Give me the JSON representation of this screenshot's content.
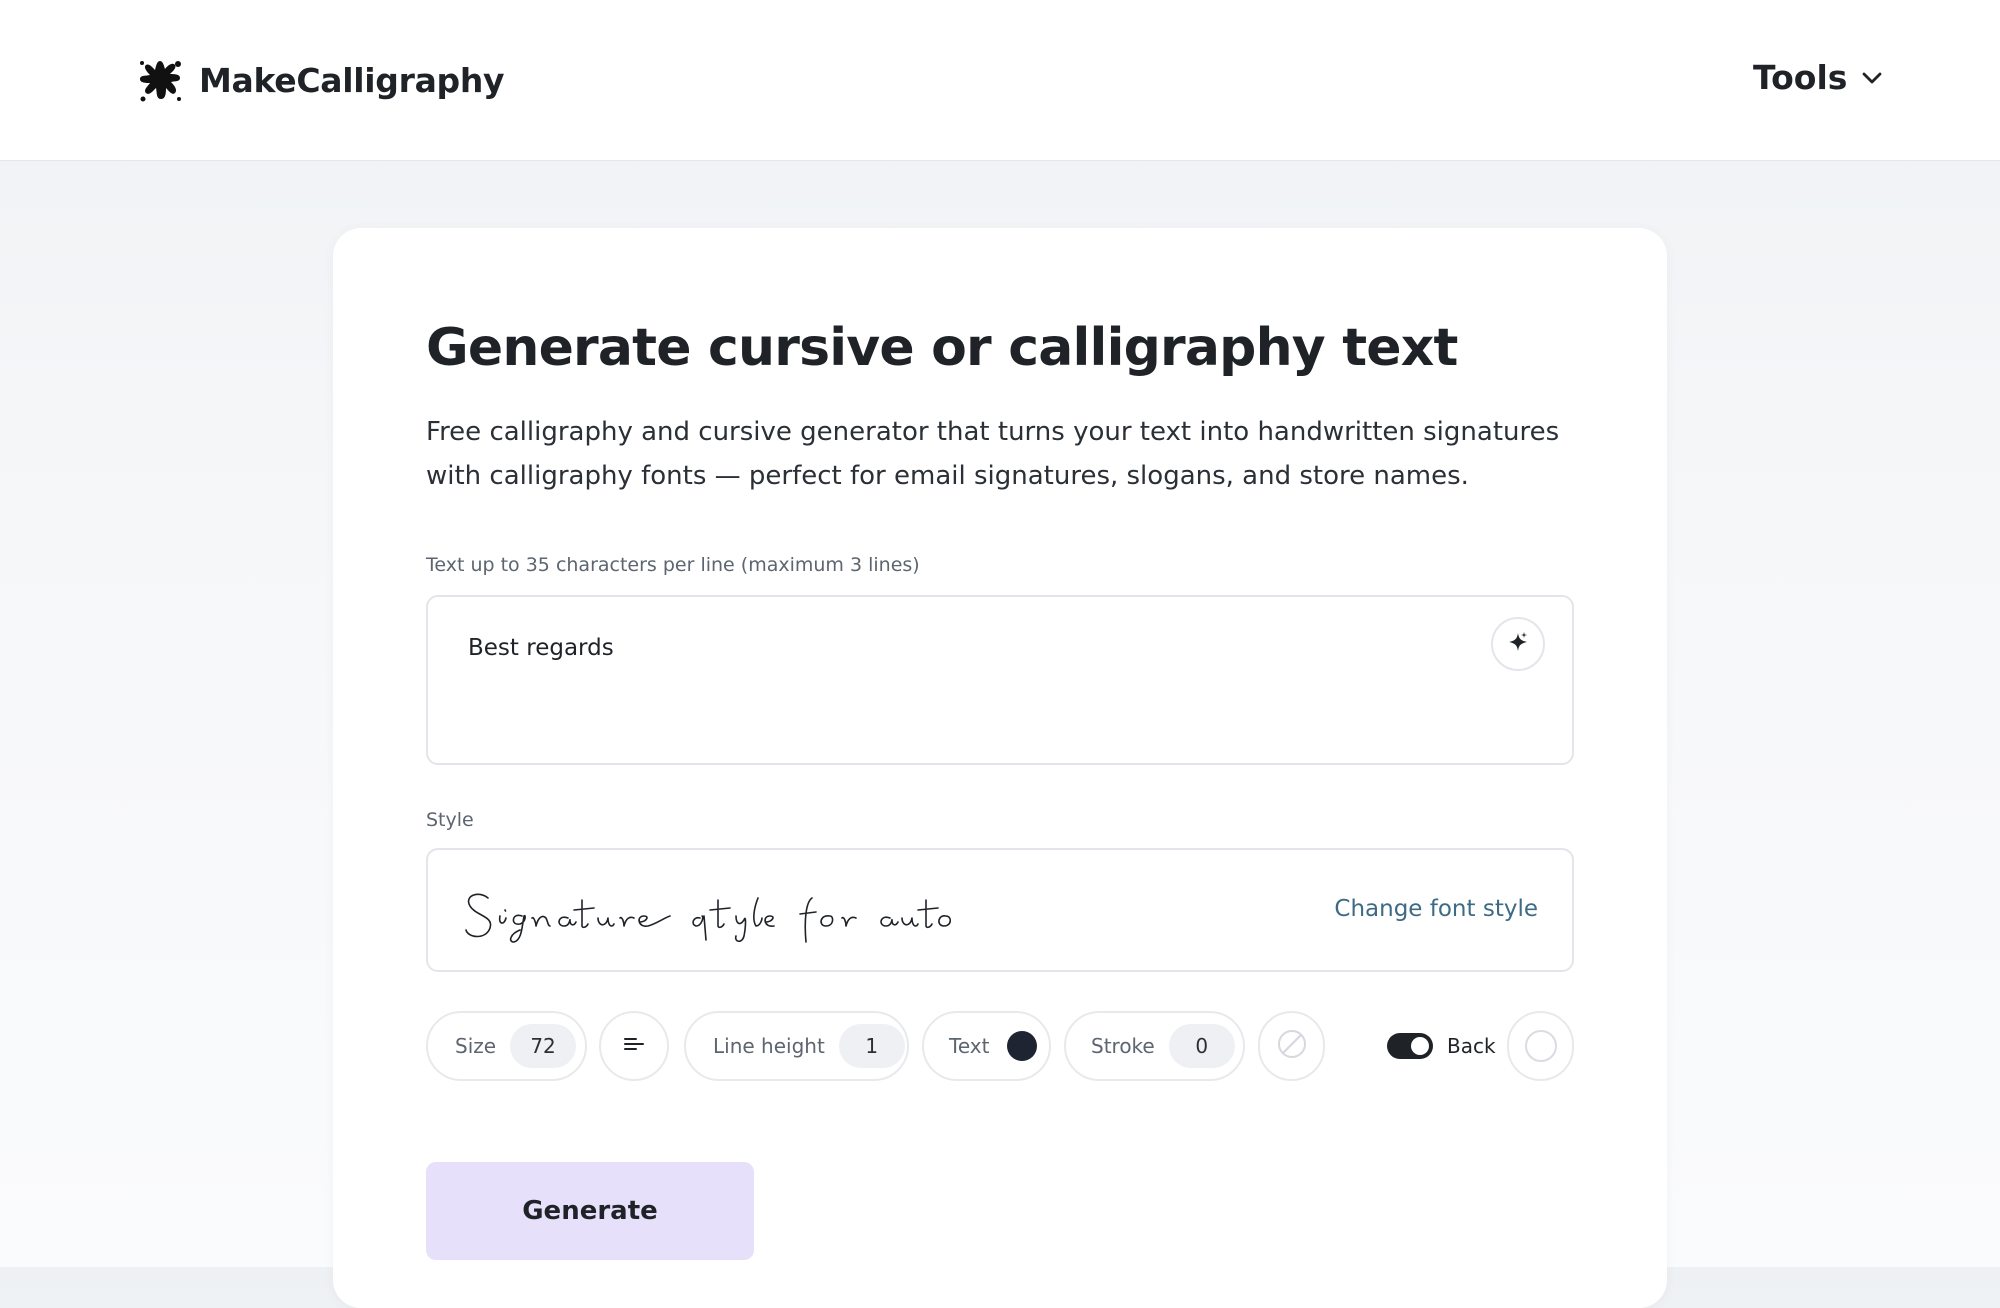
{
  "header": {
    "brand": "MakeCalligraphy",
    "tools_label": "Tools"
  },
  "main": {
    "title": "Generate cursive or calligraphy text",
    "description": "Free calligraphy and cursive generator that turns your text into handwritten signatures with calligraphy fonts — perfect for email signatures, slogans, and store names.",
    "text_label": "Text up to 35 characters per line (maximum 3 lines)",
    "text_value": "Best regards",
    "style_label": "Style",
    "style_preview": "Signature style for autographs",
    "change_font_label": "Change font style"
  },
  "controls": {
    "size_label": "Size",
    "size_value": "72",
    "line_height_label": "Line height",
    "line_height_value": "1",
    "text_color_label": "Text",
    "text_color": "#1f2433",
    "stroke_label": "Stroke",
    "stroke_value": "0",
    "back_label": "Back",
    "back_toggle_on": true
  },
  "generate_label": "Generate",
  "colors": {
    "generate_bg": "#e6e0fb",
    "link": "#3d6b86",
    "text_primary": "#1f2328"
  }
}
